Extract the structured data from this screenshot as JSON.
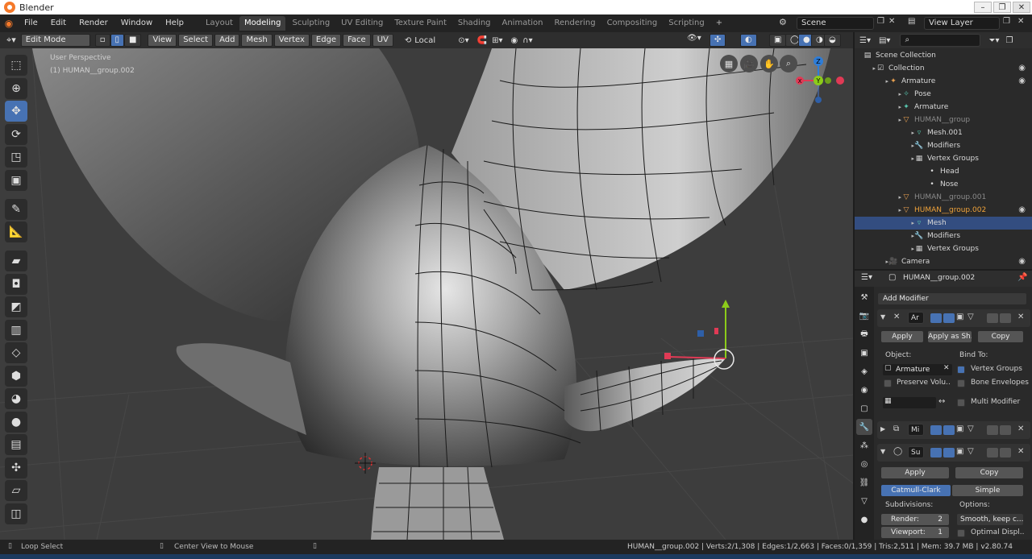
{
  "window": {
    "title": "Blender"
  },
  "menus": [
    "File",
    "Edit",
    "Render",
    "Window",
    "Help"
  ],
  "workspaces": [
    "Layout",
    "Modeling",
    "Sculpting",
    "UV Editing",
    "Texture Paint",
    "Shading",
    "Animation",
    "Rendering",
    "Compositing",
    "Scripting"
  ],
  "active_workspace": "Modeling",
  "scene": {
    "name": "Scene"
  },
  "view_layer": {
    "name": "View Layer"
  },
  "viewport_header": {
    "mode": "Edit Mode",
    "menus": [
      "View",
      "Select",
      "Add",
      "Mesh",
      "Vertex",
      "Edge",
      "Face",
      "UV"
    ],
    "transform_orientation": "Local"
  },
  "viewport": {
    "view_label": "User Perspective",
    "object_label": "(1) HUMAN__group.002"
  },
  "gizmo": {
    "x": "X",
    "y": "Y",
    "z": "Z"
  },
  "outliner": {
    "search_placeholder": "",
    "rows": [
      {
        "label": "Scene Collection",
        "indent": 0,
        "icon": "scene-collection-icon"
      },
      {
        "label": "Collection",
        "indent": 1,
        "icon": "collection-icon",
        "eye": true
      },
      {
        "label": "Armature",
        "indent": 2,
        "icon": "armature-icon",
        "eye": true
      },
      {
        "label": "Pose",
        "indent": 3,
        "icon": "pose-icon"
      },
      {
        "label": "Armature",
        "indent": 3,
        "icon": "armature-data-icon"
      },
      {
        "label": "HUMAN__group",
        "indent": 3,
        "icon": "mesh-object-icon",
        "dim": true
      },
      {
        "label": "Mesh.001",
        "indent": 4,
        "icon": "mesh-data-icon"
      },
      {
        "label": "Modifiers",
        "indent": 4,
        "icon": "wrench-icon"
      },
      {
        "label": "Vertex Groups",
        "indent": 4,
        "icon": "vertex-groups-icon"
      },
      {
        "label": "Head",
        "indent": 5,
        "icon": "dot-icon"
      },
      {
        "label": "Nose",
        "indent": 5,
        "icon": "dot-icon"
      },
      {
        "label": "HUMAN__group.001",
        "indent": 3,
        "icon": "mesh-object-icon",
        "dim": true
      },
      {
        "label": "HUMAN__group.002",
        "indent": 3,
        "icon": "mesh-object-icon",
        "hl": true,
        "eye": true
      },
      {
        "label": "Mesh",
        "indent": 4,
        "icon": "mesh-data-icon",
        "sel": true
      },
      {
        "label": "Modifiers",
        "indent": 4,
        "icon": "wrench-icon"
      },
      {
        "label": "Vertex Groups",
        "indent": 4,
        "icon": "vertex-groups-icon"
      },
      {
        "label": "Camera",
        "indent": 2,
        "icon": "camera-icon",
        "eye": true
      }
    ]
  },
  "properties": {
    "object_name": "HUMAN__group.002",
    "add_modifier": "Add Modifier",
    "armature_mod": {
      "name": "Ar",
      "apply": "Apply",
      "apply_shape": "Apply as Sh..",
      "copy": "Copy",
      "object_label": "Object:",
      "object_value": "Armature",
      "bind_label": "Bind To:",
      "preserve_volume": "Preserve Volu..",
      "vertex_groups": "Vertex Groups",
      "bone_envelopes": "Bone Envelopes",
      "multi_modifier": "Multi Modifier"
    },
    "mirror_mod": {
      "name": "Mi"
    },
    "subsurf_mod": {
      "name": "Su",
      "apply": "Apply",
      "copy": "Copy",
      "catmull": "Catmull-Clark",
      "simple": "Simple",
      "subdivisions_label": "Subdivisions:",
      "options_label": "Options:",
      "render_label": "Render:",
      "render_value": "2",
      "viewport_label": "Viewport:",
      "viewport_value": "1",
      "smooth_option": "Smooth, keep c...",
      "optimal_display": "Optimal Displ.."
    }
  },
  "status": {
    "left_action": "Loop Select",
    "mid_action": "Center View to Mouse",
    "stats": "HUMAN__group.002 | Verts:2/1,308 | Edges:1/2,663 | Faces:0/1,359 | Tris:2,511 | Mem: 39.7 MB | v2.80.74"
  },
  "colors": {
    "accent": "#4772b3",
    "active_object": "#f0a33a",
    "header": "#2e2e2e",
    "viewport_bg": "#3d3d3d"
  }
}
